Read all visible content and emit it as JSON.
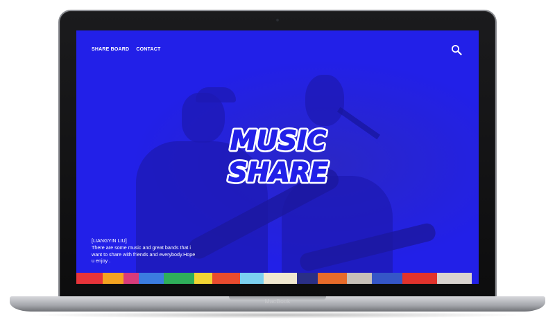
{
  "device": {
    "brand_label": "MacBook"
  },
  "nav": {
    "items": [
      {
        "label": "SHARE BOARD"
      },
      {
        "label": "CONTACT"
      }
    ],
    "search_icon": "search-icon"
  },
  "hero": {
    "logo_lines": [
      "MUSIC",
      "SHARE"
    ],
    "background_color": "#2220e8"
  },
  "caption": {
    "author": "[LIANGYIN LIU]",
    "text": "There are some music and great bands that i want to share with friends and everybody.Hope u enjoy ."
  },
  "colors": {
    "accent": "#2220e8",
    "text": "#ffffff"
  }
}
